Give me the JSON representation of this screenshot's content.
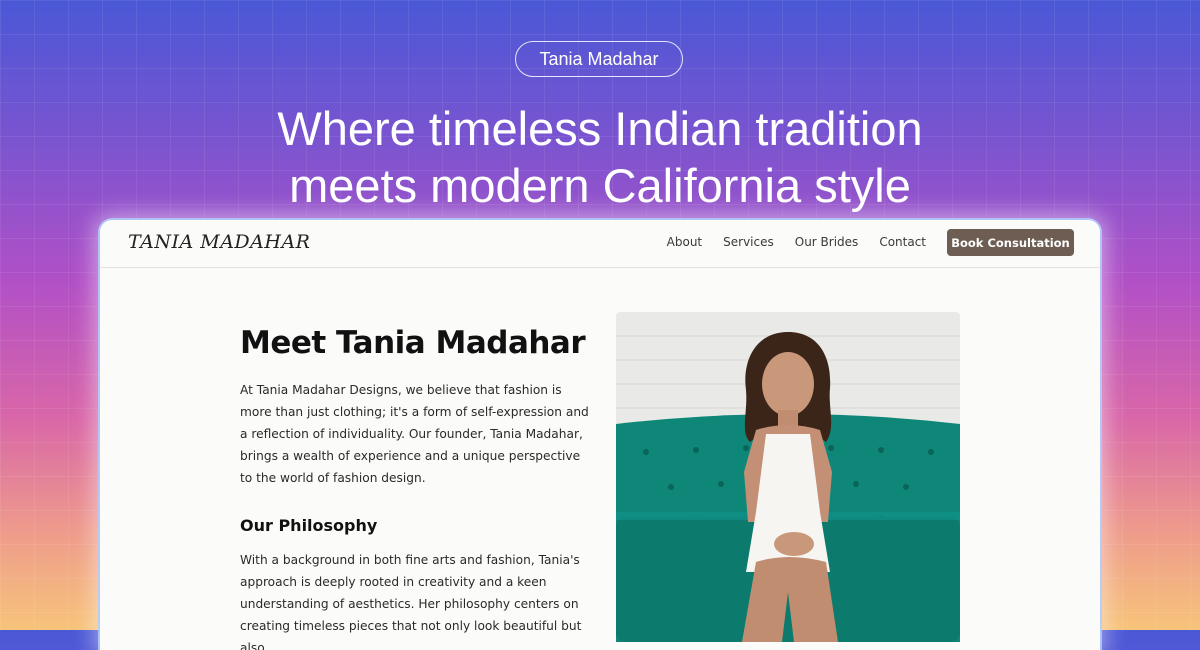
{
  "badge": "Tania Madahar",
  "headline": {
    "line1": "Where timeless Indian tradition",
    "line2": "meets modern California style"
  },
  "site": {
    "logo": "TANIA MADAHAR",
    "nav": [
      "About",
      "Services",
      "Our Brides",
      "Contact"
    ],
    "cta": "Book Consultation"
  },
  "main": {
    "title": "Meet Tania Madahar",
    "intro": "At Tania Madahar Designs, we believe that fashion is more than just clothing; it's a form of self-expression and a reflection of individuality. Our founder, Tania Madahar, brings a wealth of experience and a unique perspective to the world of fashion design.",
    "philosophy_heading": "Our Philosophy",
    "philosophy_text": "With a background in both fine arts and fashion, Tania's approach is deeply rooted in creativity and a keen understanding of aesthetics. Her philosophy centers on creating timeless pieces that not only look beautiful but also"
  },
  "colors": {
    "cta_background": "#6d5d53",
    "sofa": "#0e8778",
    "page_background": "#fbfbf9"
  }
}
